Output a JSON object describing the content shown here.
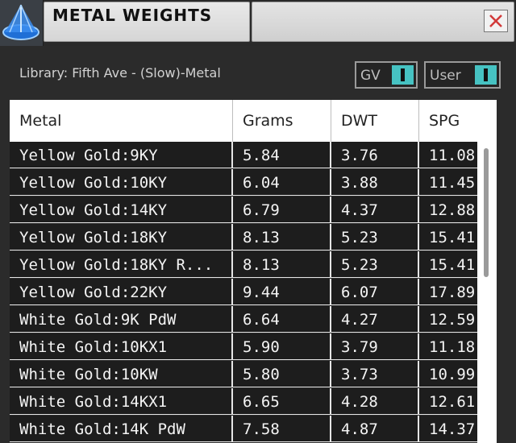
{
  "window": {
    "title": "METAL WEIGHTS",
    "icon": "app-logo-icon",
    "close_icon": "close-icon"
  },
  "library": {
    "label": "Library: Fifth Ave - (Slow)-Metal"
  },
  "toggles": {
    "gv": {
      "label": "GV",
      "state": "on"
    },
    "user": {
      "label": "User",
      "state": "on"
    },
    "accent_color": "#46c2c2"
  },
  "table": {
    "columns": [
      "Metal",
      "Grams",
      "DWT",
      "SPG"
    ],
    "rows": [
      [
        "Yellow Gold:9KY",
        "5.84",
        "3.76",
        "11.08"
      ],
      [
        "Yellow Gold:10KY",
        "6.04",
        "3.88",
        "11.45"
      ],
      [
        "Yellow Gold:14KY",
        "6.79",
        "4.37",
        "12.88"
      ],
      [
        "Yellow Gold:18KY",
        "8.13",
        "5.23",
        "15.41"
      ],
      [
        "Yellow Gold:18KY R...",
        "8.13",
        "5.23",
        "15.41"
      ],
      [
        "Yellow Gold:22KY",
        "9.44",
        "6.07",
        "17.89"
      ],
      [
        "White Gold:9K PdW",
        "6.64",
        "4.27",
        "12.59"
      ],
      [
        "White Gold:10KX1",
        "5.90",
        "3.79",
        "11.18"
      ],
      [
        "White Gold:10KW",
        "5.80",
        "3.73",
        "10.99"
      ],
      [
        "White Gold:14KX1",
        "6.65",
        "4.28",
        "12.61"
      ],
      [
        "White Gold:14K PdW",
        "7.58",
        "4.87",
        "14.37"
      ]
    ]
  }
}
